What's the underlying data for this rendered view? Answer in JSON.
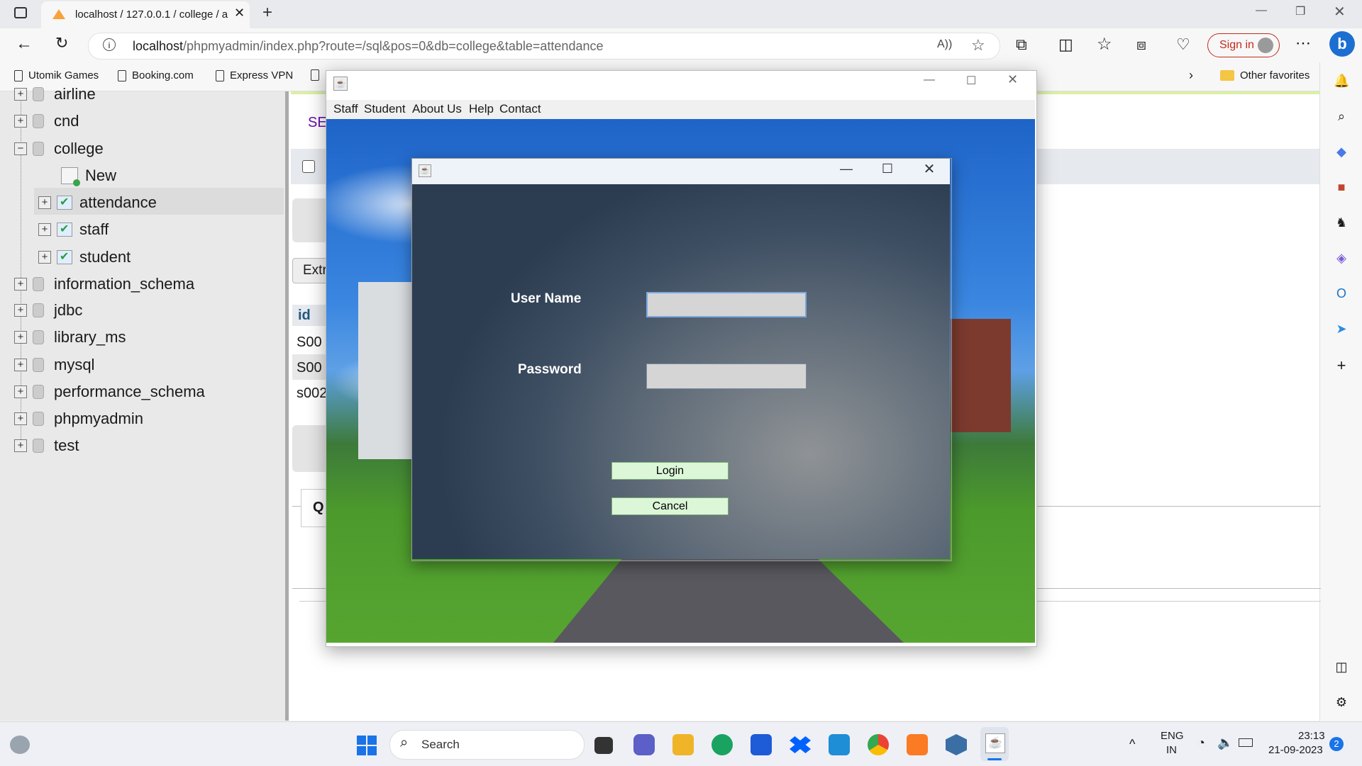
{
  "browser": {
    "tab_title": "localhost / 127.0.0.1 / college / a",
    "address_host": "localhost",
    "address_path": "/phpmyadmin/index.php?route=/sql&pos=0&db=college&table=attendance",
    "sign_in_label": "Sign in",
    "favorites": [
      "Utomik Games",
      "Booking.com",
      "Express VPN"
    ],
    "other_favorites": "Other favorites"
  },
  "phpmyadmin": {
    "databases": [
      {
        "name": "airline",
        "expanded": false
      },
      {
        "name": "cnd",
        "expanded": false
      },
      {
        "name": "college",
        "expanded": true
      },
      {
        "name": "information_schema",
        "expanded": false
      },
      {
        "name": "jdbc",
        "expanded": false
      },
      {
        "name": "library_ms",
        "expanded": false
      },
      {
        "name": "mysql",
        "expanded": false
      },
      {
        "name": "performance_schema",
        "expanded": false
      },
      {
        "name": "phpmyadmin",
        "expanded": false
      },
      {
        "name": "test",
        "expanded": false
      }
    ],
    "college_children": [
      "New",
      "attendance",
      "staff",
      "student"
    ],
    "main_fragments": {
      "se": "SE",
      "extr": "Extr",
      "id_header": "id",
      "rows": [
        "S00",
        "S00",
        "s002"
      ],
      "q": "Q"
    }
  },
  "java_app": {
    "menu": [
      "Staff",
      "Student",
      "About Us",
      "Help",
      "Contact"
    ],
    "login_dialog": {
      "username_label": "User Name",
      "username_value": "",
      "password_label": "Password",
      "password_value": "",
      "login_button": "Login",
      "cancel_button": "Cancel"
    }
  },
  "taskbar": {
    "search_placeholder": "Search",
    "language": "ENG",
    "region": "IN",
    "time": "23:13",
    "date": "21-09-2023",
    "notification_count": "2"
  }
}
